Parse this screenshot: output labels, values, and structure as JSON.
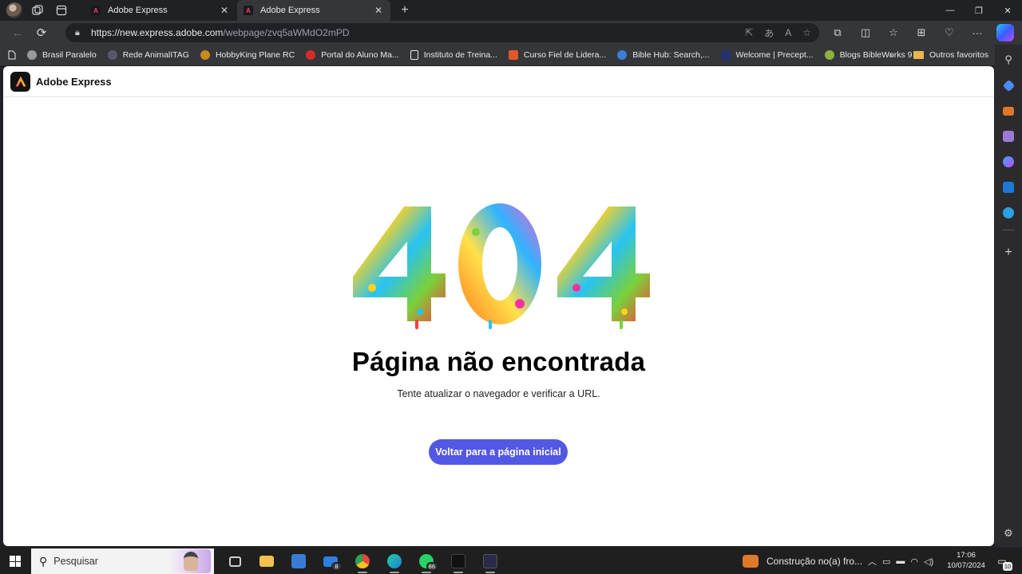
{
  "browser": {
    "tabs": [
      {
        "label": "Adobe Express",
        "active": false
      },
      {
        "label": "Adobe Express",
        "active": true
      }
    ],
    "url_host": "https://new.express.adobe.com",
    "url_path": "/webpage/zvq5aWMdO2mPD",
    "bookmarks": [
      {
        "label": "Brasil Paralelo",
        "icon": "brasil-paralelo-icon",
        "color": "#9a9a9a"
      },
      {
        "label": "Rede AnimalITAG",
        "icon": "rede-animal-icon",
        "color": "#555a66"
      },
      {
        "label": "HobbyKing Plane RC",
        "icon": "hobbyking-icon",
        "color": "#c98a1c"
      },
      {
        "label": "Portal do Aluno Ma...",
        "icon": "portal-aluno-icon",
        "color": "#d62b2b"
      },
      {
        "label": "Instituto de Treina...",
        "icon": "page-icon",
        "color": "#e8eaed"
      },
      {
        "label": "Curso Fiel de Lidera...",
        "icon": "curso-fiel-icon",
        "color": "#e0582a"
      },
      {
        "label": "Bible Hub: Search,...",
        "icon": "bible-hub-icon",
        "color": "#3b7fd6"
      },
      {
        "label": "Welcome | Precept...",
        "icon": "precept-icon",
        "color": "#26306e"
      },
      {
        "label": "Blogs BibleWorks 9",
        "icon": "bibleworks-icon",
        "color": "#8cb33a"
      }
    ],
    "other_bookmarks": "Outros favoritos"
  },
  "page": {
    "brand": "Adobe Express",
    "error_code": "404",
    "title": "Página não encontrada",
    "subtitle": "Tente atualizar o navegador e verificar a URL.",
    "home_button": "Voltar para a página inicial",
    "accent_color": "#5258e4"
  },
  "taskbar": {
    "search_placeholder": "Pesquisar",
    "apps": [
      {
        "name": "task-view",
        "color": "#cfcfcf",
        "badge": ""
      },
      {
        "name": "file-explorer",
        "color": "#f2c14e",
        "badge": ""
      },
      {
        "name": "microsoft-store",
        "color": "#3a7bd5",
        "badge": ""
      },
      {
        "name": "mail",
        "color": "#2f7fe0",
        "badge": "8"
      },
      {
        "name": "chrome",
        "color": "#e5493b",
        "badge": ""
      },
      {
        "name": "edge",
        "color": "#1fa3d6",
        "badge": ""
      },
      {
        "name": "whatsapp",
        "color": "#25d366",
        "badge": "86"
      },
      {
        "name": "adobe-express",
        "color": "#111111",
        "badge": ""
      },
      {
        "name": "adobe-express-2",
        "color": "#2a2a4a",
        "badge": ""
      }
    ],
    "weather_text": "Construção no(a) fro...",
    "time": "17:06",
    "date": "10/07/2024",
    "notifications": "10"
  }
}
